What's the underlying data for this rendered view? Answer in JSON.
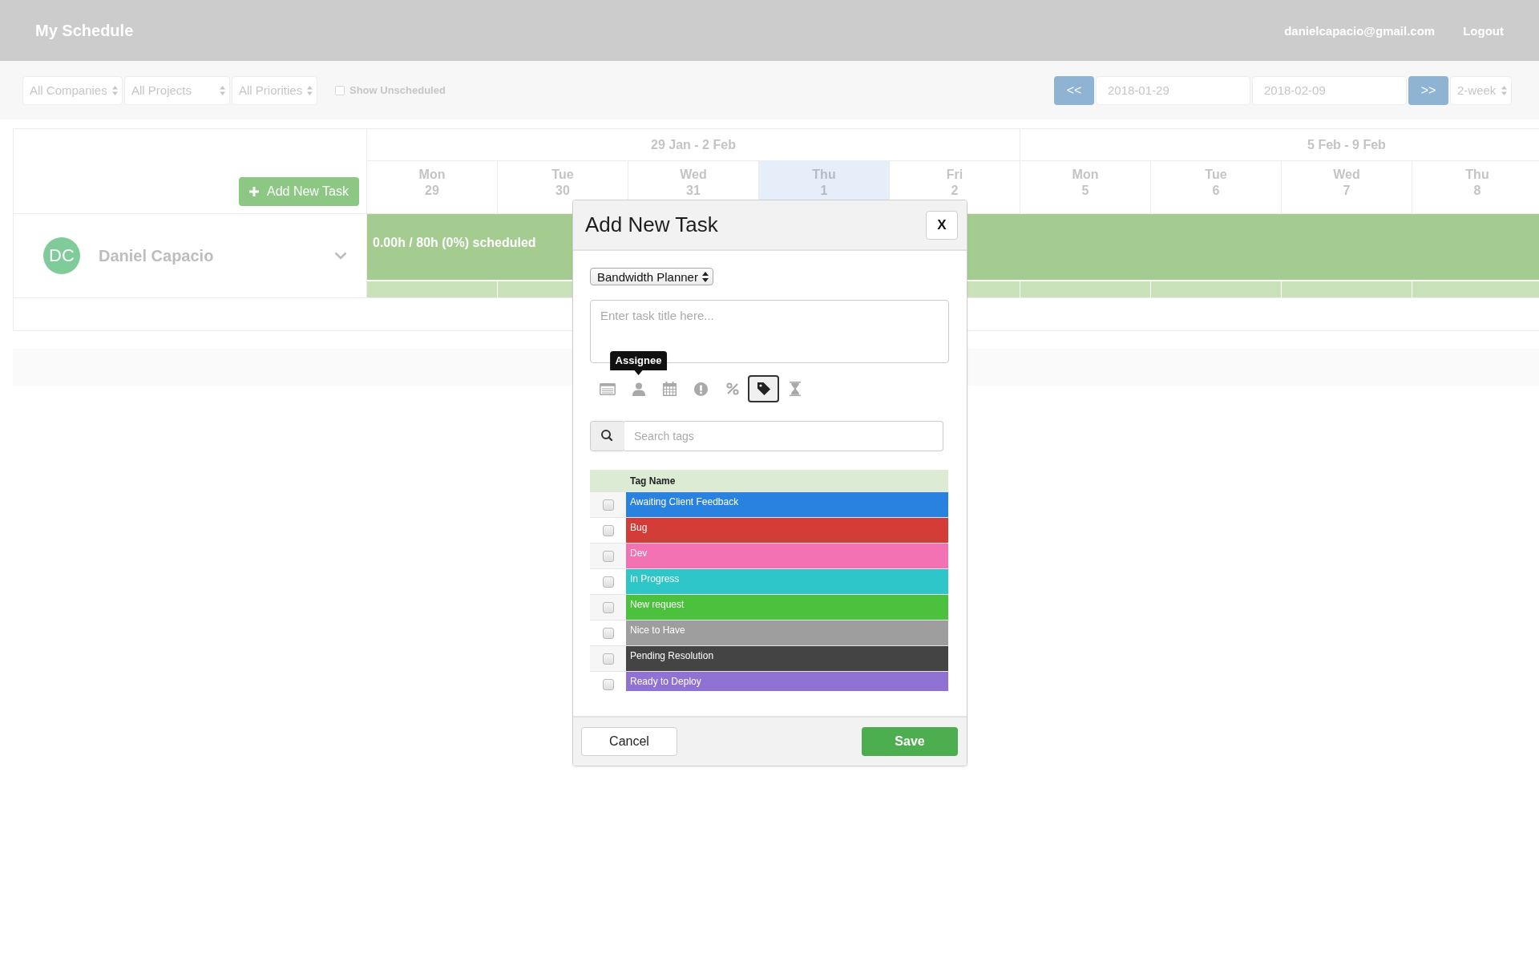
{
  "header": {
    "title": "My Schedule",
    "email": "danielcapacio@gmail.com",
    "logout": "Logout"
  },
  "filters": {
    "selects": [
      "All Companies",
      "All Projects",
      "All Priorities"
    ],
    "show_unscheduled": {
      "label": "Show Unscheduled",
      "checked": false
    },
    "prev": "<<",
    "start_date": "2018-01-29",
    "end_date": "2018-02-09",
    "next": ">>",
    "range": "2-week"
  },
  "schedule": {
    "add_task": "Add New Task",
    "weeks": [
      {
        "label": "29 Jan - 2 Feb",
        "days": [
          {
            "name": "Mon",
            "date": "29",
            "today": false
          },
          {
            "name": "Tue",
            "date": "30",
            "today": false
          },
          {
            "name": "Wed",
            "date": "31",
            "today": false
          },
          {
            "name": "Thu",
            "date": "1",
            "today": true
          },
          {
            "name": "Fri",
            "date": "2",
            "today": false
          }
        ]
      },
      {
        "label": "5 Feb - 9 Feb",
        "days": [
          {
            "name": "Mon",
            "date": "5",
            "today": false
          },
          {
            "name": "Tue",
            "date": "6",
            "today": false
          },
          {
            "name": "Wed",
            "date": "7",
            "today": false
          },
          {
            "name": "Thu",
            "date": "8",
            "today": false
          }
        ]
      }
    ],
    "people": [
      {
        "initials": "DC",
        "name": "Daniel Capacio",
        "summary": "0.00h / 80h (0%) scheduled"
      }
    ]
  },
  "modal": {
    "title": "Add New Task",
    "close": "X",
    "project": "Bandwidth Planner",
    "task_title": {
      "placeholder": "Enter task title here..."
    },
    "toolbar": [
      {
        "kind": "details",
        "selected": false
      },
      {
        "kind": "assignee",
        "selected": false,
        "tooltip": "Assignee"
      },
      {
        "kind": "date",
        "selected": false
      },
      {
        "kind": "priority",
        "selected": false
      },
      {
        "kind": "progress",
        "selected": false
      },
      {
        "kind": "tags",
        "selected": true
      },
      {
        "kind": "estimate",
        "selected": false
      }
    ],
    "tag_search": {
      "placeholder": "Search tags"
    },
    "tag_table": {
      "column": "Tag Name",
      "tags": [
        {
          "name": "Awaiting Client Feedback",
          "color": "#2a82e0",
          "checked": false
        },
        {
          "name": "Bug",
          "color": "#d33c37",
          "checked": false
        },
        {
          "name": "Dev",
          "color": "#f272b3",
          "checked": false
        },
        {
          "name": "In Progress",
          "color": "#2ec6c9",
          "checked": false
        },
        {
          "name": "New request",
          "color": "#4bc13d",
          "checked": false
        },
        {
          "name": "Nice to Have",
          "color": "#9e9e9e",
          "checked": false
        },
        {
          "name": "Pending Resolution",
          "color": "#444444",
          "checked": false
        },
        {
          "name": "Ready to Deploy",
          "color": "#9071d4",
          "checked": false
        }
      ]
    },
    "cancel": "Cancel",
    "save": "Save"
  }
}
